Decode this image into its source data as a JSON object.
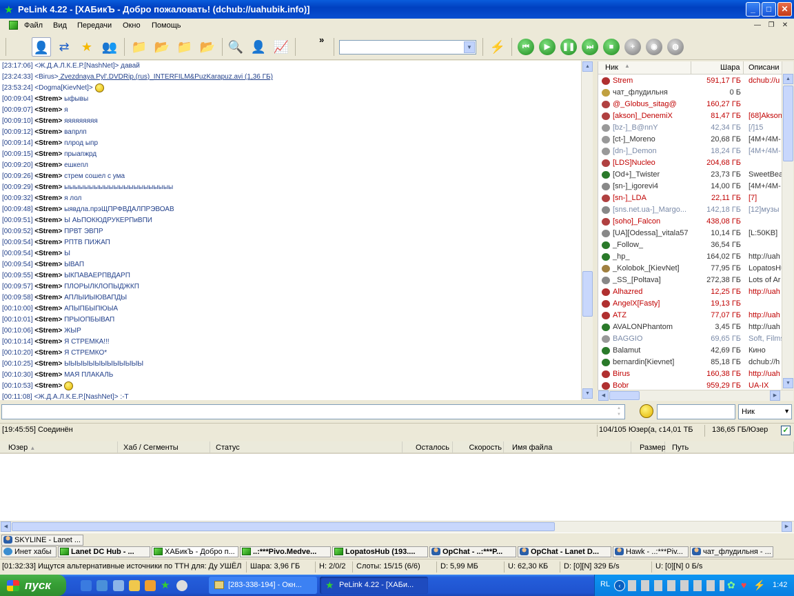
{
  "window": {
    "title": "PeLink  4.22 - [ХАБикЪ - Добро пожаловать! (dchub://uahubik.info)]",
    "min": "_",
    "max": "□",
    "close": "✕"
  },
  "menu": {
    "items": [
      "Файл",
      "Вид",
      "Передачи",
      "Окно",
      "Помощь"
    ]
  },
  "toolbar": {
    "overflow": "»",
    "search_value": ""
  },
  "chat": {
    "lines": [
      {
        "ts": "[23:17:06]",
        "nick": "<Ж.Д.А.Л.К.Е.Р.[NashNet]>",
        "text": " давай",
        "type": "other"
      },
      {
        "ts": "[23:24:33]",
        "nick": "<Birus>",
        "text": " Zvezdnaya.Pyl'.DVDRip.(rus)_INTERFILM&PuzKarapuz.avi (1,36 ГБ)",
        "type": "link"
      },
      {
        "ts": "[23:53:24]",
        "nick": "<Dogma[KievNet]>",
        "text": " ",
        "type": "smile"
      },
      {
        "ts": "[00:09:04]",
        "nick": "<Strem>",
        "text": " ыфывы",
        "type": "strem"
      },
      {
        "ts": "[00:09:07]",
        "nick": "<Strem>",
        "text": " я",
        "type": "strem"
      },
      {
        "ts": "[00:09:10]",
        "nick": "<Strem>",
        "text": " яяяяяяяяя",
        "type": "strem"
      },
      {
        "ts": "[00:09:12]",
        "nick": "<Strem>",
        "text": " вапрлп",
        "type": "strem"
      },
      {
        "ts": "[00:09:14]",
        "nick": "<Strem>",
        "text": " плрод ыпр",
        "type": "strem"
      },
      {
        "ts": "[00:09:15]",
        "nick": "<Strem>",
        "text": " прыапжрд",
        "type": "strem"
      },
      {
        "ts": "[00:09:20]",
        "nick": "<Strem>",
        "text": " ешкепл",
        "type": "strem"
      },
      {
        "ts": "[00:09:26]",
        "nick": "<Strem>",
        "text": "  стрем сошел с ума",
        "type": "strem"
      },
      {
        "ts": "[00:09:29]",
        "nick": "<Strem>",
        "text": " ыыыыыыыыыыыыыыыыыыыыыы",
        "type": "strem"
      },
      {
        "ts": "[00:09:32]",
        "nick": "<Strem>",
        "text": "  я лол",
        "type": "strem"
      },
      {
        "ts": "[00:09:48]",
        "nick": "<Strem>",
        "text": " ыявдла.прэЩПРФВДАЛПРЭВОАВ",
        "type": "strem"
      },
      {
        "ts": "[00:09:51]",
        "nick": "<Strem>",
        "text": " Ы АЬПОКЮДРУКЕРПиВПИ",
        "type": "strem"
      },
      {
        "ts": "[00:09:52]",
        "nick": "<Strem>",
        "text": " ПРВТ ЭВПР",
        "type": "strem"
      },
      {
        "ts": "[00:09:54]",
        "nick": "<Strem>",
        "text": " РПТВ ПИЖАП",
        "type": "strem"
      },
      {
        "ts": "[00:09:54]",
        "nick": "<Strem>",
        "text": " Ы",
        "type": "strem"
      },
      {
        "ts": "[00:09:54]",
        "nick": "<Strem>",
        "text": " ЫВАП",
        "type": "strem"
      },
      {
        "ts": "[00:09:55]",
        "nick": "<Strem>",
        "text": " ЫКПАВАЕРПВДАРП",
        "type": "strem"
      },
      {
        "ts": "[00:09:57]",
        "nick": "<Strem>",
        "text": " ПЛОРЫЛКЛОПЫДЖКП",
        "type": "strem"
      },
      {
        "ts": "[00:09:58]",
        "nick": "<Strem>",
        "text": " АПЛЫИЫЮВАПДЫ",
        "type": "strem"
      },
      {
        "ts": "[00:10:00]",
        "nick": "<Strem>",
        "text": " АПЫПБЫПЮЫА",
        "type": "strem"
      },
      {
        "ts": "[00:10:01]",
        "nick": "<Strem>",
        "text": " ПРЫОПБЫВАП",
        "type": "strem"
      },
      {
        "ts": "[00:10:06]",
        "nick": "<Strem>",
        "text": " ЖЫР",
        "type": "strem"
      },
      {
        "ts": "[00:10:14]",
        "nick": "<Strem>",
        "text": " Я СТРЕМКА!!!",
        "type": "strem"
      },
      {
        "ts": "[00:10:20]",
        "nick": "<Strem>",
        "text": " Я СТРЕМКО*",
        "type": "strem"
      },
      {
        "ts": "[00:10:25]",
        "nick": "<Strem>",
        "text": " ЫЫЫЫЫЫЫЫЫЫЫЫЫ",
        "type": "strem"
      },
      {
        "ts": "[00:10:30]",
        "nick": "<Strem>",
        "text": " МАЯ ПЛАКАЛЬ",
        "type": "strem"
      },
      {
        "ts": "[00:10:53]",
        "nick": "<Strem>",
        "text": " ",
        "type": "strem-smile"
      },
      {
        "ts": "[00:11:08]",
        "nick": "<Ж.Д.А.Л.К.Е.Р.[NashNet]>",
        "text": "  :-Т",
        "type": "other"
      }
    ]
  },
  "userlist": {
    "headers": {
      "nick": "Ник",
      "share": "Шара",
      "desc": "Описани"
    },
    "users": [
      {
        "nick": "Strem",
        "share": "591,17 ГБ",
        "desc": "dchub://u",
        "color": "#c00000",
        "icon": "#b03030"
      },
      {
        "nick": "чат_флудильня",
        "share": "0 Б",
        "desc": "",
        "color": "#333333",
        "icon": "#c0a040"
      },
      {
        "nick": "@_Globus_sitag@",
        "share": "160,27 ГБ",
        "desc": "",
        "color": "#c00000",
        "icon": "#b04040"
      },
      {
        "nick": "[akson]_DenemiX",
        "share": "81,47 ГБ",
        "desc": "[68]Akson",
        "color": "#c00000",
        "icon": "#b04040"
      },
      {
        "nick": "[bz-]_B@nnY",
        "share": "42,34 ГБ",
        "desc": "[/]15",
        "color": "#7a8aa8",
        "icon": "#999999"
      },
      {
        "nick": "[ct-]_Moreno",
        "share": "20,68 ГБ",
        "desc": "[4M+/4M-",
        "color": "#333333",
        "icon": "#999999"
      },
      {
        "nick": "[dn-]_Demon",
        "share": "18,24 ГБ",
        "desc": "[4M+/4M-",
        "color": "#7a8aa8",
        "icon": "#999999"
      },
      {
        "nick": "[LDS]Nucleo",
        "share": "204,68 ГБ",
        "desc": "",
        "color": "#c00000",
        "icon": "#b04040"
      },
      {
        "nick": "[Od+]_Twister",
        "share": "23,73 ГБ",
        "desc": "SweetBea",
        "color": "#333333",
        "icon": "#2a7a2a"
      },
      {
        "nick": "[sn-]_igorevi4",
        "share": "14,00 ГБ",
        "desc": "[4M+/4M-",
        "color": "#333333",
        "icon": "#888888"
      },
      {
        "nick": "[sn-]_LDA",
        "share": "22,11 ГБ",
        "desc": "[7]",
        "color": "#c00000",
        "icon": "#b04040"
      },
      {
        "nick": "[sns.net.ua-]_Margo...",
        "share": "142,18 ГБ",
        "desc": "[12]музы",
        "color": "#7a8aa8",
        "icon": "#888888"
      },
      {
        "nick": "[soho]_Falcon",
        "share": "438,08 ГБ",
        "desc": "",
        "color": "#c00000",
        "icon": "#b04040"
      },
      {
        "nick": "[UA][Odessa]_vitala57",
        "share": "10,14 ГБ",
        "desc": "[L:50KB]",
        "color": "#333333",
        "icon": "#888888"
      },
      {
        "nick": "_Follow_",
        "share": "36,54 ГБ",
        "desc": "",
        "color": "#333333",
        "icon": "#2a7a2a"
      },
      {
        "nick": "_hp_",
        "share": "164,02 ГБ",
        "desc": "http://uah",
        "color": "#333333",
        "icon": "#2a7a2a"
      },
      {
        "nick": "_Kolobok_[KievNet]",
        "share": "77,95 ГБ",
        "desc": "LopatosHu",
        "color": "#333333",
        "icon": "#a08040"
      },
      {
        "nick": "_SS_[Poltava]",
        "share": "272,38 ГБ",
        "desc": "Lots of Ar",
        "color": "#333333",
        "icon": "#888888"
      },
      {
        "nick": "Alhazred",
        "share": "12,25 ГБ",
        "desc": "http://uah",
        "color": "#c00000",
        "icon": "#b03030"
      },
      {
        "nick": "AngelX[Fasty]",
        "share": "19,13 ГБ",
        "desc": "",
        "color": "#c00000",
        "icon": "#b03030"
      },
      {
        "nick": "ATZ",
        "share": "77,07 ГБ",
        "desc": "http://uah",
        "color": "#c00000",
        "icon": "#b03030"
      },
      {
        "nick": "AVALONPhantom",
        "share": "3,45 ГБ",
        "desc": "http://uah",
        "color": "#333333",
        "icon": "#2a7a2a"
      },
      {
        "nick": "BAGGIO",
        "share": "69,65 ГБ",
        "desc": "Soft, Films",
        "color": "#7a8aa8",
        "icon": "#999999"
      },
      {
        "nick": "Balamut",
        "share": "42,69 ГБ",
        "desc": "Кино",
        "color": "#333333",
        "icon": "#2a7a2a"
      },
      {
        "nick": "bernardin[Kievnet]",
        "share": "85,18 ГБ",
        "desc": "dchub://h",
        "color": "#333333",
        "icon": "#2a7a2a"
      },
      {
        "nick": "Birus",
        "share": "160,38 ГБ",
        "desc": "http://uah",
        "color": "#c00000",
        "icon": "#b03030"
      },
      {
        "nick": "Bobr",
        "share": "959,29 ГБ",
        "desc": "UA-IX",
        "color": "#c00000",
        "icon": "#b03030"
      }
    ]
  },
  "input": {
    "message_value": "",
    "filter_value": "",
    "filter_column": "Ник"
  },
  "status": {
    "left": "[19:45:55] Соединён",
    "users": "104/105 Юзер(а, ов",
    "total": "14,01 ТБ",
    "per_user": "136,65 ГБ/Юзер"
  },
  "transfers": {
    "headers": [
      "Юзер",
      "Хаб / Сегменты",
      "Статус",
      "Осталось",
      "Скорость",
      "Имя файла",
      "Размер",
      "Путь"
    ]
  },
  "tabs": {
    "row1": [
      {
        "label": "SKYLINE - Lanet ...",
        "icon": "person"
      }
    ],
    "row2": [
      {
        "label": "Инет хабы",
        "icon": "net"
      },
      {
        "label": "Lanet DC Hub - ...",
        "icon": "cube"
      },
      {
        "label": "ХАБикЪ - Добро п...",
        "icon": "cube",
        "active": true
      },
      {
        "label": "..:***Pivo.Medve...",
        "icon": "cube"
      },
      {
        "label": "LopatosHub (193....",
        "icon": "cube"
      },
      {
        "label": "OpChat - ..:***P...",
        "icon": "person"
      },
      {
        "label": "OpChat - Lanet D...",
        "icon": "person"
      },
      {
        "label": "Hawk - ..:***Piv...",
        "icon": "person"
      },
      {
        "label": "чат_флудильня - ...",
        "icon": "person"
      }
    ]
  },
  "statusbar": {
    "msg": "[01:32:33] Ищутся альтернативные источники по ТТН для: Ду УШЁЛ",
    "share": "Шара: 3,96 ГБ",
    "hubs": "H: 2/0/2",
    "slots": "Слоты: 15/15 (6/6)",
    "down": "D: 5,99 МБ",
    "up": "U: 62,30 КБ",
    "down_rate": "D: [0][N] 329 Б/s",
    "up_rate": "U: [0][N] 0 Б/s"
  },
  "taskbar": {
    "start": "пуск",
    "tasks": [
      {
        "label": "[283-338-194] - Окн..."
      },
      {
        "label": "PeLink  4.22 - [ХАБи..."
      }
    ],
    "lang": "RL",
    "clock": "1:42"
  }
}
